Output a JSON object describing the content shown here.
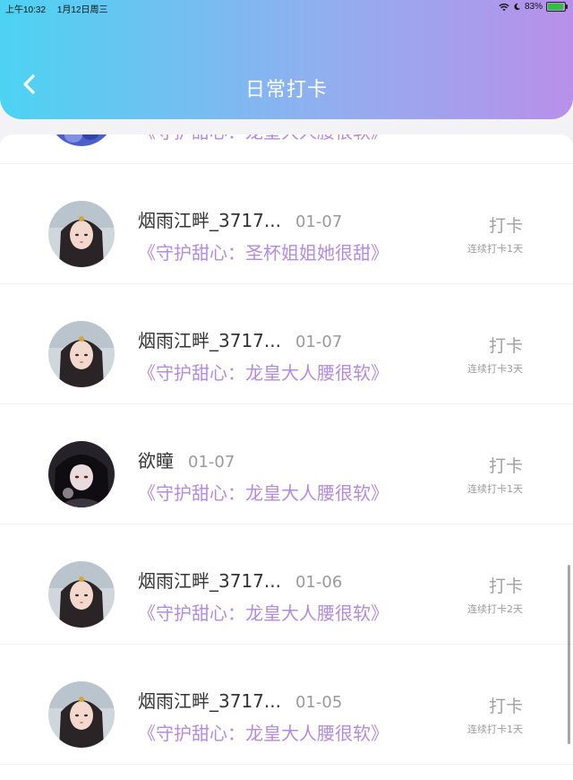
{
  "status_bar": {
    "time": "上午10:32",
    "date": "1月12日周三",
    "battery": "83%"
  },
  "header": {
    "title": "日常打卡"
  },
  "checkins": [
    {
      "user": "",
      "date": "",
      "book": "《守护甜心：龙皇大人腰很软》",
      "action": "",
      "streak": "",
      "avatar": "blue"
    },
    {
      "user": "烟雨江畔_3717...",
      "date": "01-07",
      "book": "《守护甜心：圣杯姐姐她很甜》",
      "action": "打卡",
      "streak": "连续打卡1天",
      "avatar": "girl"
    },
    {
      "user": "烟雨江畔_3717...",
      "date": "01-07",
      "book": "《守护甜心：龙皇大人腰很软》",
      "action": "打卡",
      "streak": "连续打卡3天",
      "avatar": "girl"
    },
    {
      "user": "欲瞳",
      "date": "01-07",
      "book": "《守护甜心：龙皇大人腰很软》",
      "action": "打卡",
      "streak": "连续打卡1天",
      "avatar": "dark"
    },
    {
      "user": "烟雨江畔_3717...",
      "date": "01-06",
      "book": "《守护甜心：龙皇大人腰很软》",
      "action": "打卡",
      "streak": "连续打卡2天",
      "avatar": "girl"
    },
    {
      "user": "烟雨江畔_3717...",
      "date": "01-05",
      "book": "《守护甜心：龙皇大人腰很软》",
      "action": "打卡",
      "streak": "连续打卡1天",
      "avatar": "girl"
    }
  ],
  "colors": {
    "header_start": "#4cd3f3",
    "header_end": "#b890ea",
    "book_title": "#b48be0",
    "muted": "#a0a0a0"
  }
}
